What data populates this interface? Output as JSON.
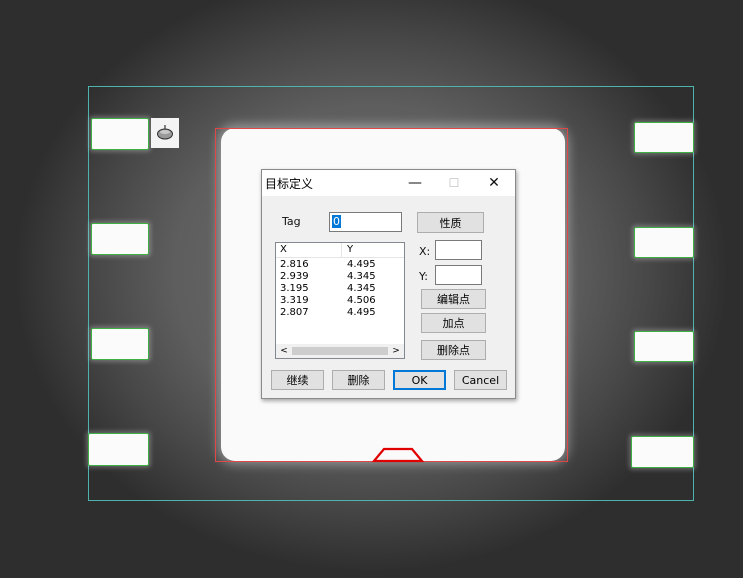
{
  "dialog": {
    "title": "目标定义",
    "minimize_glyph": "—",
    "maximize_glyph": "☐",
    "close_glyph": "✕",
    "tag_label": "Tag",
    "tag_value": "0",
    "property_button": "性质",
    "x_label": "X:",
    "y_label": "Y:",
    "x_value": "",
    "y_value": "",
    "edit_point_button": "编辑点",
    "add_point_button": "加点",
    "delete_point_button": "删除点",
    "continue_button": "继续",
    "delete_button": "删除",
    "ok_button": "OK",
    "cancel_button": "Cancel",
    "list": {
      "columns": [
        "X",
        "Y"
      ],
      "rows": [
        {
          "x": "2.816",
          "y": "4.495"
        },
        {
          "x": "2.939",
          "y": "4.345"
        },
        {
          "x": "3.195",
          "y": "4.345"
        },
        {
          "x": "3.319",
          "y": "4.506"
        },
        {
          "x": "2.807",
          "y": "4.495"
        }
      ],
      "scroll_left_glyph": "<",
      "scroll_right_glyph": ">"
    }
  },
  "colors": {
    "inspection_frame": "#4fb3ad",
    "component_outline": "#e04848",
    "pad_outline": "#3cb043",
    "target_shape": "#e00000"
  },
  "icons": {
    "probe": "pcb-probe-icon"
  }
}
